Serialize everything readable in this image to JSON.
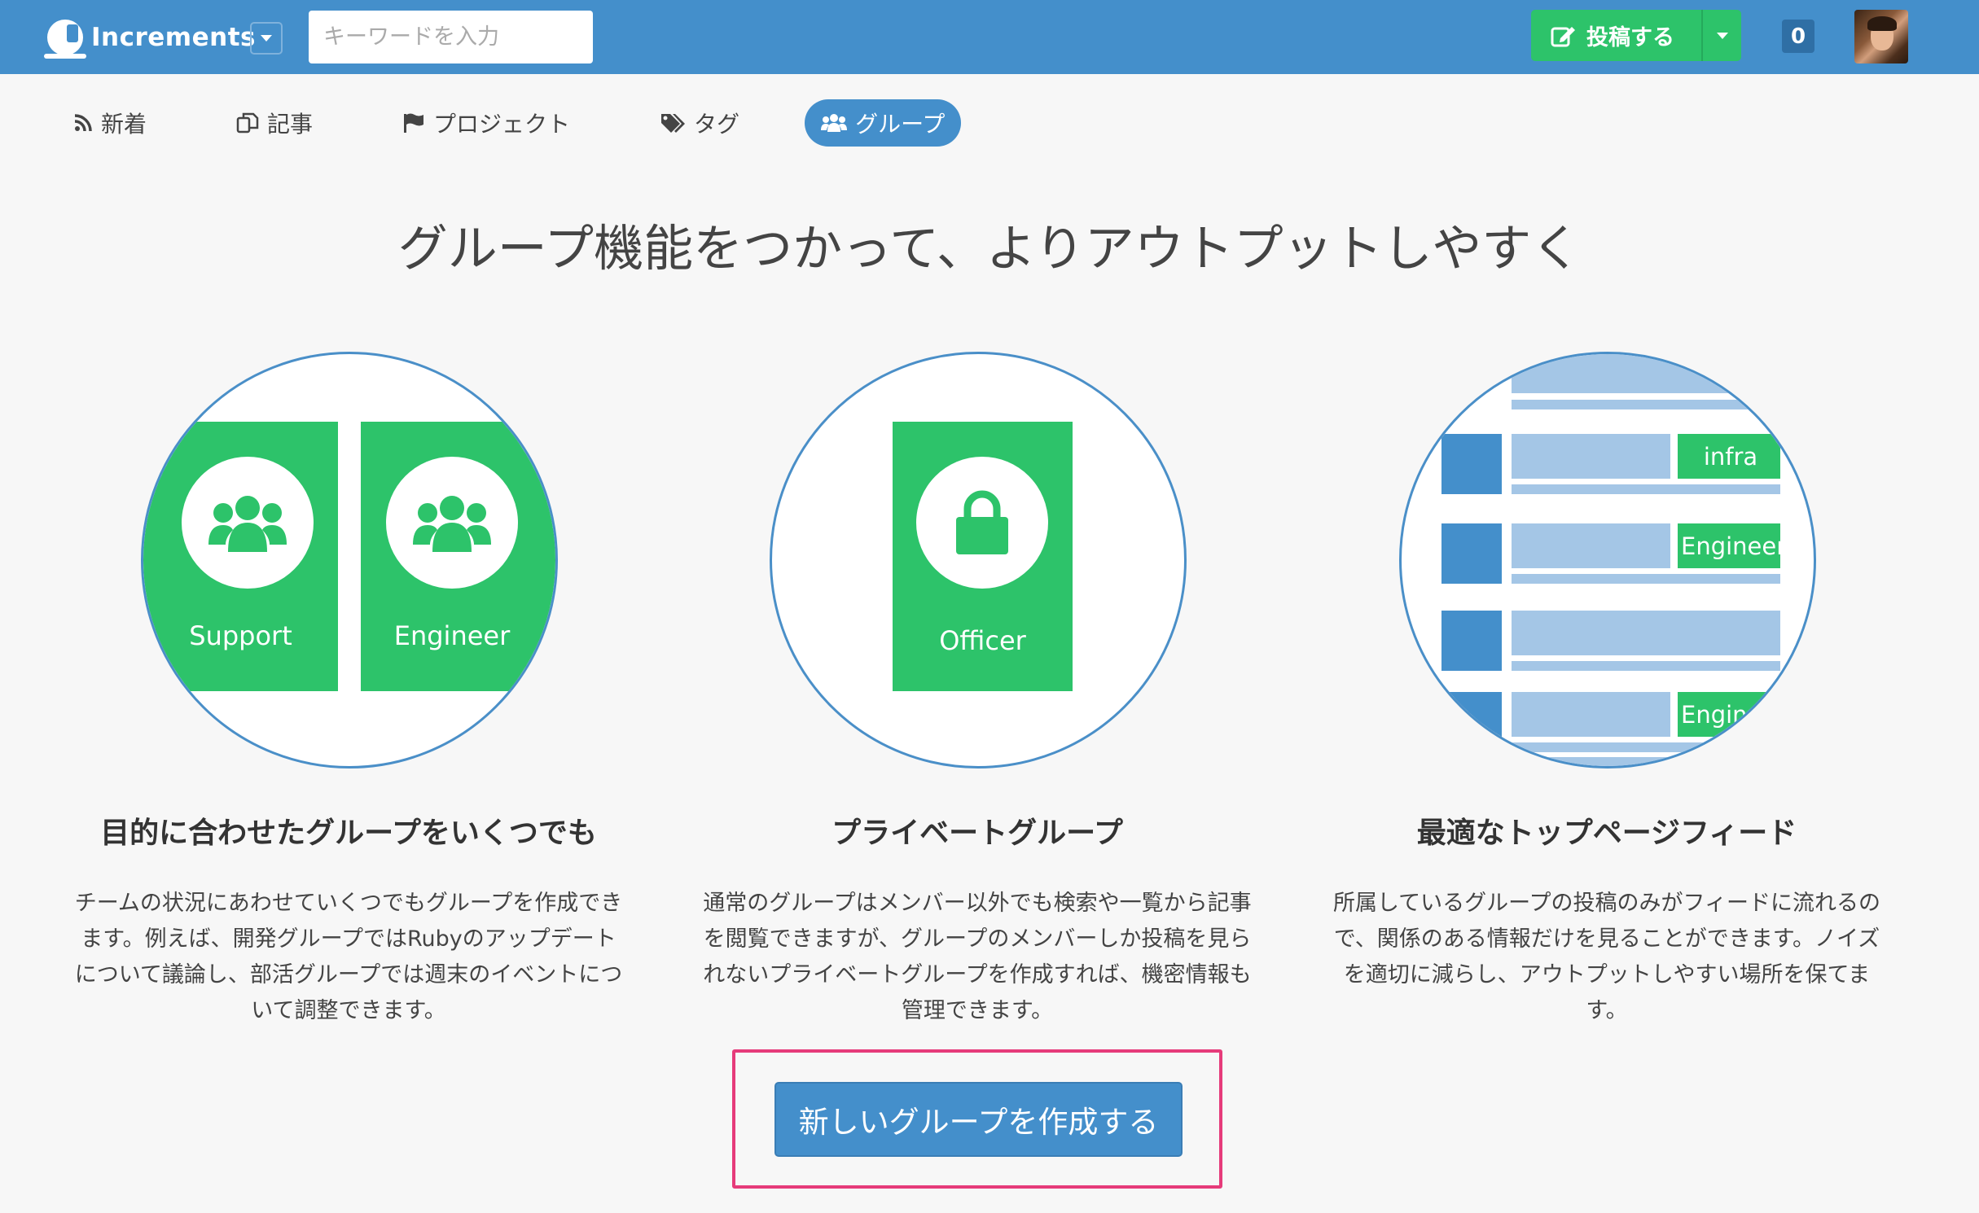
{
  "header": {
    "brand": "Increments",
    "search_placeholder": "キーワードを入力",
    "post_button": "投稿する",
    "notification_count": "0"
  },
  "nav": {
    "items": [
      {
        "label": "新着",
        "icon": "rss-icon"
      },
      {
        "label": "記事",
        "icon": "copy-icon"
      },
      {
        "label": "プロジェクト",
        "icon": "flag-icon"
      },
      {
        "label": "タグ",
        "icon": "tags-icon"
      },
      {
        "label": "グループ",
        "icon": "group-icon",
        "active": true
      }
    ]
  },
  "main": {
    "headline": "グループ機能をつかって、よりアウトプットしやすく",
    "features": [
      {
        "title": "目的に合わせたグループをいくつでも",
        "description": "チームの状況にあわせていくつでもグループを作成できます。例えば、開発グループではRubyのアップデートについて議論し、部活グループでは週末のイベントについて調整できます。",
        "cards": [
          "Support",
          "Engineer"
        ]
      },
      {
        "title": "プライベートグループ",
        "description": "通常のグループはメンバー以外でも検索や一覧から記事を閲覧できますが、グループのメンバーしか投稿を見られないプライベートグループを作成すれば、機密情報も管理できます。",
        "cards": [
          "Officer"
        ]
      },
      {
        "title": "最適なトップページフィード",
        "description": "所属しているグループの投稿のみがフィードに流れるので、関係のある情報だけを見ることができます。ノイズを適切に減らし、アウトプットしやすい場所を保てます。",
        "tags": [
          "infra",
          "Engineer",
          "Engineer"
        ]
      }
    ],
    "cta_button": "新しいグループを作成する"
  },
  "colors": {
    "header": "#448fcb",
    "green": "#2dc36a",
    "highlight": "#e63b7a"
  }
}
